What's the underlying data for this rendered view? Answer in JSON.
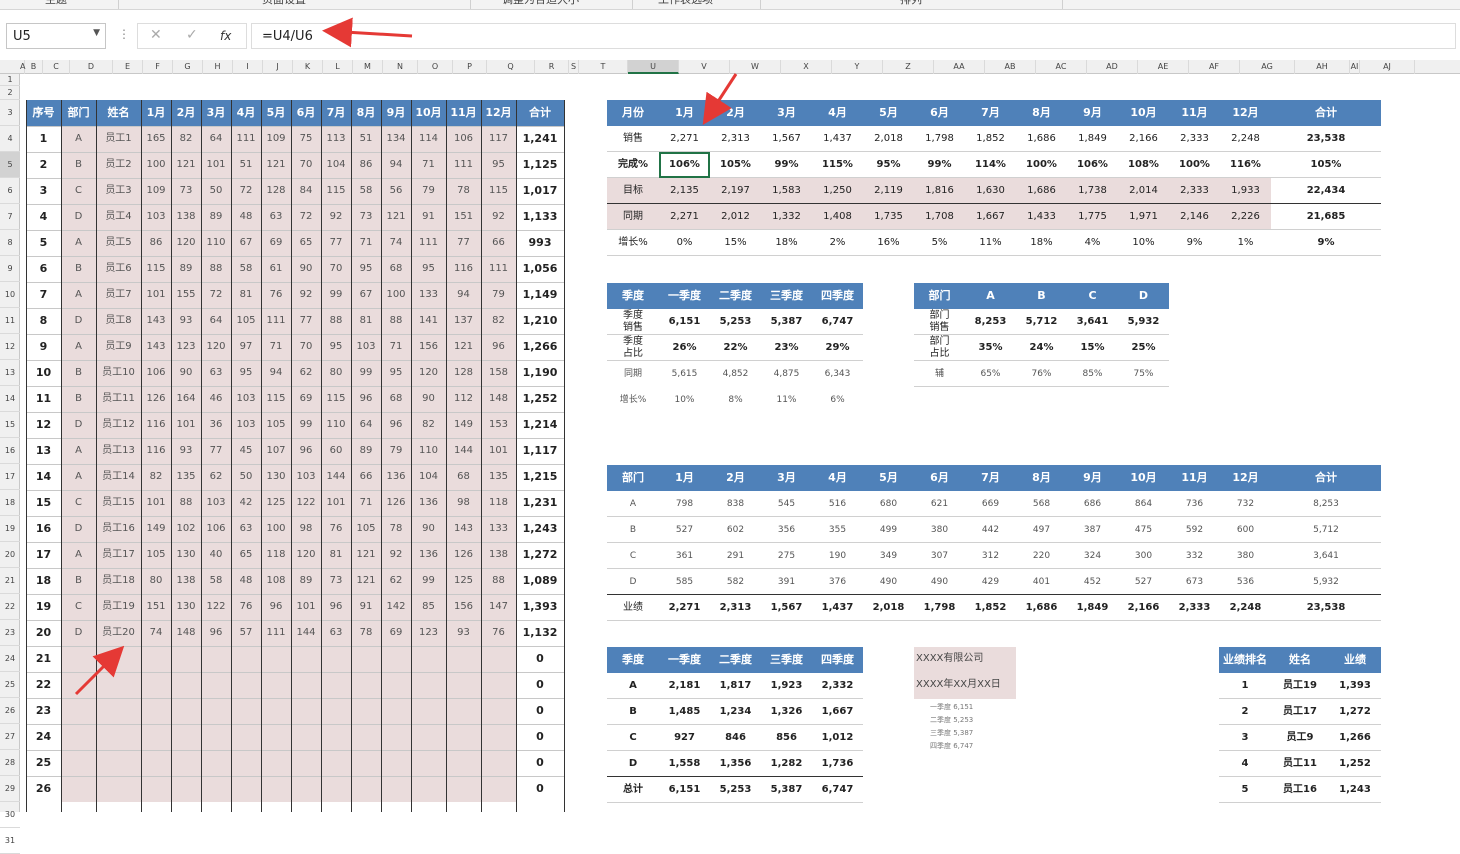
{
  "ribbon": {
    "groups": [
      "主题",
      "页面设置",
      "调整为合适大小",
      "工作表选项",
      "排列"
    ]
  },
  "formula_bar": {
    "name_box": "U5",
    "cancel": "✕",
    "enter": "✓",
    "fx": "fx",
    "formula": "=U4/U6"
  },
  "columns": [
    "A",
    "B",
    "C",
    "D",
    "E",
    "F",
    "G",
    "H",
    "I",
    "J",
    "K",
    "L",
    "M",
    "N",
    "O",
    "P",
    "Q",
    "R",
    "S",
    "T",
    "U",
    "V",
    "W",
    "X",
    "Y",
    "Z",
    "AA",
    "AB",
    "AC",
    "AD",
    "AE",
    "AF",
    "AG",
    "AH",
    "AI",
    "AJ"
  ],
  "selected_column": "U",
  "selected_row": "5",
  "rows": [
    "1",
    "2",
    "3",
    "4",
    "5",
    "6",
    "7",
    "8",
    "9",
    "10",
    "11",
    "12",
    "13",
    "14",
    "15",
    "16",
    "17",
    "18",
    "19",
    "20",
    "21",
    "22",
    "23",
    "24",
    "25",
    "26",
    "27",
    "28",
    "29",
    "30",
    "31"
  ],
  "left_table": {
    "headers": [
      "序号",
      "部门",
      "姓名",
      "1月",
      "2月",
      "3月",
      "4月",
      "5月",
      "6月",
      "7月",
      "8月",
      "9月",
      "10月",
      "11月",
      "12月",
      "合计"
    ],
    "rows": [
      [
        "1",
        "A",
        "员工1",
        "165",
        "82",
        "64",
        "111",
        "109",
        "75",
        "113",
        "51",
        "134",
        "114",
        "106",
        "117",
        "1,241"
      ],
      [
        "2",
        "B",
        "员工2",
        "100",
        "121",
        "101",
        "51",
        "121",
        "70",
        "104",
        "86",
        "94",
        "71",
        "111",
        "95",
        "1,125"
      ],
      [
        "3",
        "C",
        "员工3",
        "109",
        "73",
        "50",
        "72",
        "128",
        "84",
        "115",
        "58",
        "56",
        "79",
        "78",
        "115",
        "1,017"
      ],
      [
        "4",
        "D",
        "员工4",
        "103",
        "138",
        "89",
        "48",
        "63",
        "72",
        "92",
        "73",
        "121",
        "91",
        "151",
        "92",
        "1,133"
      ],
      [
        "5",
        "A",
        "员工5",
        "86",
        "120",
        "110",
        "67",
        "69",
        "65",
        "77",
        "71",
        "74",
        "111",
        "77",
        "66",
        "993"
      ],
      [
        "6",
        "B",
        "员工6",
        "115",
        "89",
        "88",
        "58",
        "61",
        "90",
        "70",
        "95",
        "68",
        "95",
        "116",
        "111",
        "1,056"
      ],
      [
        "7",
        "A",
        "员工7",
        "101",
        "155",
        "72",
        "81",
        "76",
        "92",
        "99",
        "67",
        "100",
        "133",
        "94",
        "79",
        "1,149"
      ],
      [
        "8",
        "D",
        "员工8",
        "143",
        "93",
        "64",
        "105",
        "111",
        "77",
        "88",
        "81",
        "88",
        "141",
        "137",
        "82",
        "1,210"
      ],
      [
        "9",
        "A",
        "员工9",
        "143",
        "123",
        "120",
        "97",
        "71",
        "70",
        "95",
        "103",
        "71",
        "156",
        "121",
        "96",
        "1,266"
      ],
      [
        "10",
        "B",
        "员工10",
        "106",
        "90",
        "63",
        "95",
        "94",
        "62",
        "80",
        "99",
        "95",
        "120",
        "128",
        "158",
        "1,190"
      ],
      [
        "11",
        "B",
        "员工11",
        "126",
        "164",
        "46",
        "103",
        "115",
        "69",
        "115",
        "96",
        "68",
        "90",
        "112",
        "148",
        "1,252"
      ],
      [
        "12",
        "D",
        "员工12",
        "116",
        "101",
        "36",
        "103",
        "105",
        "99",
        "110",
        "64",
        "96",
        "82",
        "149",
        "153",
        "1,214"
      ],
      [
        "13",
        "A",
        "员工13",
        "116",
        "93",
        "77",
        "45",
        "107",
        "96",
        "60",
        "89",
        "79",
        "110",
        "144",
        "101",
        "1,117"
      ],
      [
        "14",
        "A",
        "员工14",
        "82",
        "135",
        "62",
        "50",
        "130",
        "103",
        "144",
        "66",
        "136",
        "104",
        "68",
        "135",
        "1,215"
      ],
      [
        "15",
        "C",
        "员工15",
        "101",
        "88",
        "103",
        "42",
        "125",
        "122",
        "101",
        "71",
        "126",
        "136",
        "98",
        "118",
        "1,231"
      ],
      [
        "16",
        "D",
        "员工16",
        "149",
        "102",
        "106",
        "63",
        "100",
        "98",
        "76",
        "105",
        "78",
        "90",
        "143",
        "133",
        "1,243"
      ],
      [
        "17",
        "A",
        "员工17",
        "105",
        "130",
        "40",
        "65",
        "118",
        "120",
        "81",
        "121",
        "92",
        "136",
        "126",
        "138",
        "1,272"
      ],
      [
        "18",
        "B",
        "员工18",
        "80",
        "138",
        "58",
        "48",
        "108",
        "89",
        "73",
        "121",
        "62",
        "99",
        "125",
        "88",
        "1,089"
      ],
      [
        "19",
        "C",
        "员工19",
        "151",
        "130",
        "122",
        "76",
        "96",
        "101",
        "96",
        "91",
        "142",
        "85",
        "156",
        "147",
        "1,393"
      ],
      [
        "20",
        "D",
        "员工20",
        "74",
        "148",
        "96",
        "57",
        "111",
        "144",
        "63",
        "78",
        "69",
        "123",
        "93",
        "76",
        "1,132"
      ],
      [
        "21",
        "",
        "",
        "",
        "",
        "",
        "",
        "",
        "",
        "",
        "",
        "",
        "",
        "",
        "",
        "0"
      ],
      [
        "22",
        "",
        "",
        "",
        "",
        "",
        "",
        "",
        "",
        "",
        "",
        "",
        "",
        "",
        "",
        "0"
      ],
      [
        "23",
        "",
        "",
        "",
        "",
        "",
        "",
        "",
        "",
        "",
        "",
        "",
        "",
        "",
        "",
        "0"
      ],
      [
        "24",
        "",
        "",
        "",
        "",
        "",
        "",
        "",
        "",
        "",
        "",
        "",
        "",
        "",
        "",
        "0"
      ],
      [
        "25",
        "",
        "",
        "",
        "",
        "",
        "",
        "",
        "",
        "",
        "",
        "",
        "",
        "",
        "",
        "0"
      ],
      [
        "26",
        "",
        "",
        "",
        "",
        "",
        "",
        "",
        "",
        "",
        "",
        "",
        "",
        "",
        "",
        "0"
      ]
    ]
  },
  "monthly_table": {
    "headers": [
      "月份",
      "1月",
      "2月",
      "3月",
      "4月",
      "5月",
      "6月",
      "7月",
      "8月",
      "9月",
      "10月",
      "11月",
      "12月",
      "合计"
    ],
    "rows": [
      [
        "销售",
        "2,271",
        "2,313",
        "1,567",
        "1,437",
        "2,018",
        "1,798",
        "1,852",
        "1,686",
        "1,849",
        "2,166",
        "2,333",
        "2,248",
        "23,538"
      ],
      [
        "完成%",
        "106%",
        "105%",
        "99%",
        "115%",
        "95%",
        "99%",
        "114%",
        "100%",
        "106%",
        "108%",
        "100%",
        "116%",
        "105%"
      ],
      [
        "目标",
        "2,135",
        "2,197",
        "1,583",
        "1,250",
        "2,119",
        "1,816",
        "1,630",
        "1,686",
        "1,738",
        "2,014",
        "2,333",
        "1,933",
        "22,434"
      ],
      [
        "同期",
        "2,271",
        "2,012",
        "1,332",
        "1,408",
        "1,735",
        "1,708",
        "1,667",
        "1,433",
        "1,775",
        "1,971",
        "2,146",
        "2,226",
        "21,685"
      ],
      [
        "增长%",
        "0%",
        "15%",
        "18%",
        "2%",
        "16%",
        "5%",
        "11%",
        "18%",
        "4%",
        "10%",
        "9%",
        "1%",
        "9%"
      ]
    ]
  },
  "quarter_table": {
    "headers": [
      "季度",
      "一季度",
      "二季度",
      "三季度",
      "四季度"
    ],
    "rows": [
      [
        "季度\n销售",
        "6,151",
        "5,253",
        "5,387",
        "6,747"
      ],
      [
        "季度\n占比",
        "26%",
        "22%",
        "23%",
        "29%"
      ],
      [
        "同期",
        "5,615",
        "4,852",
        "4,875",
        "6,343"
      ],
      [
        "增长%",
        "10%",
        "8%",
        "11%",
        "6%"
      ]
    ]
  },
  "dept_table": {
    "headers": [
      "部门",
      "A",
      "B",
      "C",
      "D"
    ],
    "rows": [
      [
        "部门\n销售",
        "8,253",
        "5,712",
        "3,641",
        "5,932"
      ],
      [
        "部门\n占比",
        "35%",
        "24%",
        "15%",
        "25%"
      ],
      [
        "辅",
        "65%",
        "76%",
        "85%",
        "75%"
      ]
    ]
  },
  "dept_month_table": {
    "headers": [
      "部门",
      "1月",
      "2月",
      "3月",
      "4月",
      "5月",
      "6月",
      "7月",
      "8月",
      "9月",
      "10月",
      "11月",
      "12月",
      "合计"
    ],
    "rows": [
      [
        "A",
        "798",
        "838",
        "545",
        "516",
        "680",
        "621",
        "669",
        "568",
        "686",
        "864",
        "736",
        "732",
        "8,253"
      ],
      [
        "B",
        "527",
        "602",
        "356",
        "355",
        "499",
        "380",
        "442",
        "497",
        "387",
        "475",
        "592",
        "600",
        "5,712"
      ],
      [
        "C",
        "361",
        "291",
        "275",
        "190",
        "349",
        "307",
        "312",
        "220",
        "324",
        "300",
        "332",
        "380",
        "3,641"
      ],
      [
        "D",
        "585",
        "582",
        "391",
        "376",
        "490",
        "490",
        "429",
        "401",
        "452",
        "527",
        "673",
        "536",
        "5,932"
      ],
      [
        "业绩",
        "2,271",
        "2,313",
        "1,567",
        "1,437",
        "2,018",
        "1,798",
        "1,852",
        "1,686",
        "1,849",
        "2,166",
        "2,333",
        "2,248",
        "23,538"
      ]
    ]
  },
  "dept_quarter_table": {
    "headers": [
      "季度",
      "一季度",
      "二季度",
      "三季度",
      "四季度"
    ],
    "rows": [
      [
        "A",
        "2,181",
        "1,817",
        "1,923",
        "2,332"
      ],
      [
        "B",
        "1,485",
        "1,234",
        "1,326",
        "1,667"
      ],
      [
        "C",
        "927",
        "846",
        "856",
        "1,012"
      ],
      [
        "D",
        "1,558",
        "1,356",
        "1,282",
        "1,736"
      ],
      [
        "总计",
        "6,151",
        "5,253",
        "5,387",
        "6,747"
      ]
    ]
  },
  "company_box": {
    "name": "XXXX有限公司",
    "date": "XXXX年XX月XX日",
    "lines": [
      "一季度  6,151",
      "二季度  5,253",
      "三季度  5,387",
      "四季度  6,747"
    ]
  },
  "rank_table": {
    "headers": [
      "业绩排名",
      "姓名",
      "业绩"
    ],
    "rows": [
      [
        "1",
        "员工19",
        "1,393"
      ],
      [
        "2",
        "员工17",
        "1,272"
      ],
      [
        "3",
        "员工9",
        "1,266"
      ],
      [
        "4",
        "员工11",
        "1,252"
      ],
      [
        "5",
        "员工16",
        "1,243"
      ]
    ]
  },
  "colors": {
    "header_blue": "#4f81b9",
    "pink": "#eadcdc",
    "selection_green": "#217346",
    "arrow_red": "#e53935"
  }
}
